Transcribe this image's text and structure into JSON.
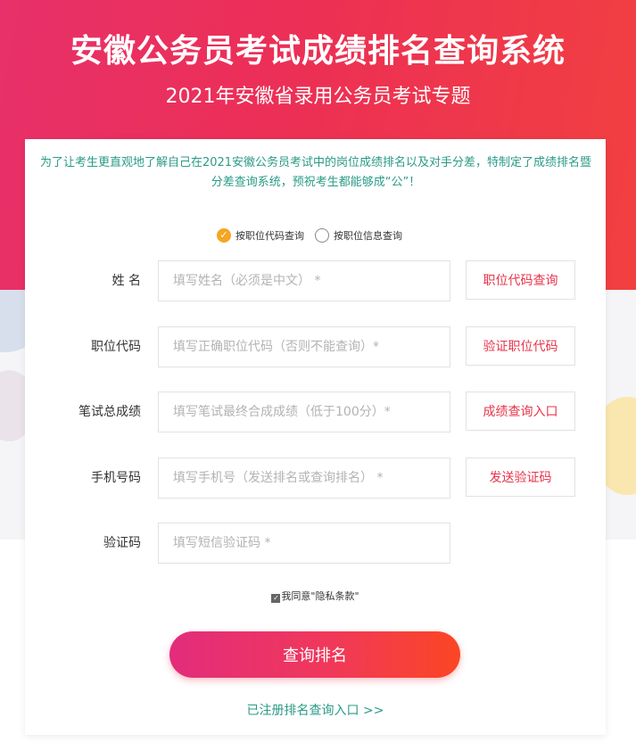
{
  "header": {
    "title": "安徽公务员考试成绩排名查询系统",
    "subtitle": "2021年安徽省录用公务员考试专题"
  },
  "intro": "为了让考生更直观地了解自己在2021安徽公务员考试中的岗位成绩排名以及对手分差，特制定了成绩排名暨分差查询系统，预祝考生都能够成“公”！",
  "query_mode": {
    "options": [
      "按职位代码查询",
      "按职位信息查询"
    ],
    "selected": 0
  },
  "form": {
    "name": {
      "label": "姓 名",
      "placeholder": "填写姓名（必须是中文） *",
      "button": "职位代码查询"
    },
    "position_code": {
      "label": "职位代码",
      "placeholder": "填写正确职位代码（否则不能查询）*",
      "button": "验证职位代码"
    },
    "score": {
      "label": "笔试总成绩",
      "placeholder": "填写笔试最终合成成绩（低于100分）*",
      "button": "成绩查询入口"
    },
    "phone": {
      "label": "手机号码",
      "placeholder": "填写手机号（发送排名或查询排名） *",
      "button": "发送验证码"
    },
    "code": {
      "label": "验证码",
      "placeholder": "填写短信验证码 *"
    }
  },
  "agree": {
    "checked": true,
    "label": "我同意\"隐私条款\""
  },
  "submit_label": "查询排名",
  "registered_link": "已注册排名查询入口 >>",
  "colors": {
    "accent": "#ec2f55",
    "link": "#2a9a86",
    "button_text": "#e8344b",
    "radio_on": "#f5a623"
  }
}
